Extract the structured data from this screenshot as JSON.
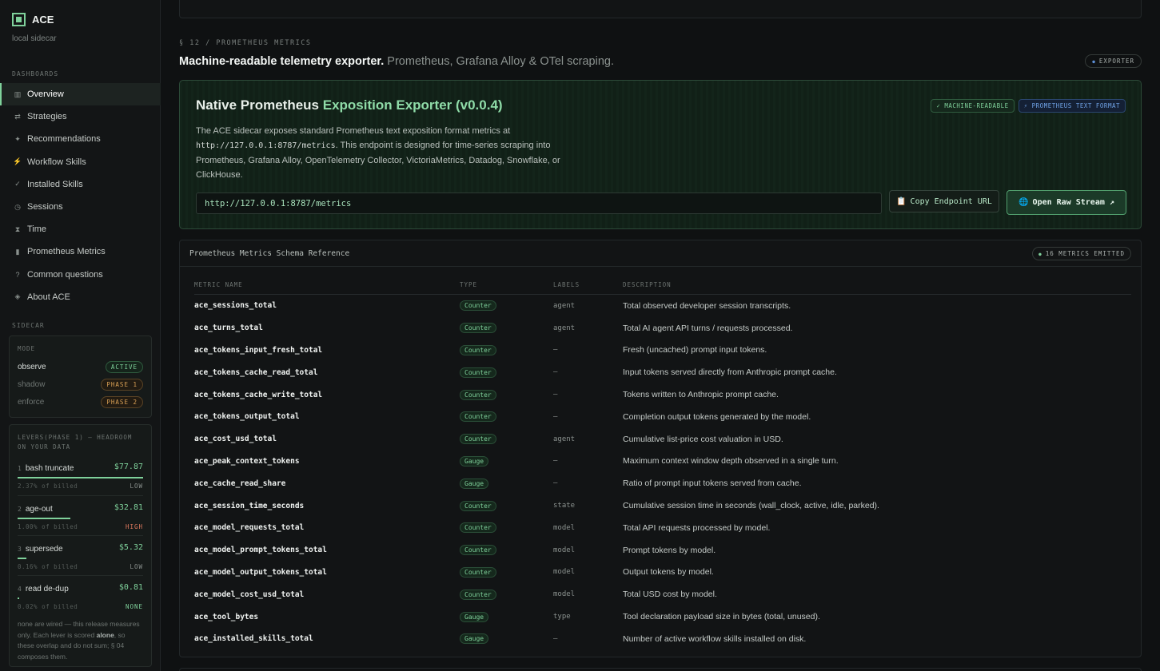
{
  "brand": {
    "name": "ACE",
    "subtitle": "local sidecar"
  },
  "sidebar": {
    "dashboards_label": "DASHBOARDS",
    "items": [
      {
        "icon": "grid-icon",
        "glyph": "▥",
        "label": "Overview",
        "active": true
      },
      {
        "icon": "arrows-icon",
        "glyph": "⇄",
        "label": "Strategies"
      },
      {
        "icon": "sparkle-icon",
        "glyph": "✦",
        "label": "Recommendations"
      },
      {
        "icon": "bolt-icon",
        "glyph": "⚡",
        "label": "Workflow Skills"
      },
      {
        "icon": "check-icon",
        "glyph": "✓",
        "label": "Installed Skills"
      },
      {
        "icon": "clock-icon",
        "glyph": "◷",
        "label": "Sessions"
      },
      {
        "icon": "hourglass-icon",
        "glyph": "⧗",
        "label": "Time"
      },
      {
        "icon": "bar-chart-icon",
        "glyph": "▮",
        "label": "Prometheus Metrics"
      },
      {
        "icon": "question-icon",
        "glyph": "?",
        "label": "Common questions"
      },
      {
        "icon": "diamond-icon",
        "glyph": "◈",
        "label": "About ACE"
      }
    ],
    "sidecar_label": "SIDECAR",
    "mode": {
      "label": "MODE",
      "rows": [
        {
          "name": "observe",
          "badge": "ACTIVE",
          "tone": "green"
        },
        {
          "name": "shadow",
          "badge": "PHASE 1",
          "tone": "amber"
        },
        {
          "name": "enforce",
          "badge": "PHASE 2",
          "tone": "amber"
        }
      ]
    },
    "levers": {
      "label_line1": "LEVERS(PHASE 1) — HEADROOM",
      "label_line2": "ON YOUR DATA",
      "items": [
        {
          "num": "1",
          "name": "bash truncate",
          "value": "$77.87",
          "pct": "2.37% of billed",
          "risk": "LOW",
          "fill": 1.0
        },
        {
          "num": "2",
          "name": "age-out",
          "value": "$32.81",
          "pct": "1.00% of billed",
          "risk": "HIGH",
          "fill": 0.42
        },
        {
          "num": "3",
          "name": "supersede",
          "value": "$5.32",
          "pct": "0.16% of billed",
          "risk": "LOW",
          "fill": 0.07
        },
        {
          "num": "4",
          "name": "read de-dup",
          "value": "$0.81",
          "pct": "0.02% of billed",
          "risk": "NONE",
          "fill": 0.01
        }
      ],
      "note_pre": "none are wired — this release measures only. Each lever is scored ",
      "note_bold": "alone",
      "note_post": ", so these overlap and do not sum; § 04 composes them."
    }
  },
  "section": {
    "kicker": "§ 12 / PROMETHEUS METRICS",
    "title_bold": "Machine-readable telemetry exporter.",
    "title_rest": " Prometheus, Grafana Alloy & OTel scraping.",
    "pill": "EXPORTER"
  },
  "hero": {
    "title_a": "Native Prometheus ",
    "title_b": "Exposition Exporter (v0.0.4)",
    "badge_a": "✓ MACHINE-READABLE",
    "badge_b": "⚡ PROMETHEUS TEXT FORMAT",
    "desc_a": "The ACE sidecar exposes standard Prometheus text exposition format metrics at ",
    "desc_code": "http://127.0.0.1:8787/metrics",
    "desc_b": ". This endpoint is designed for time-series scraping into Prometheus, Grafana Alloy, OpenTelemetry Collector, VictoriaMetrics, Datadog, Snowflake, or ClickHouse.",
    "url": "http://127.0.0.1:8787/metrics",
    "copy_label": "Copy Endpoint URL",
    "open_label": "Open Raw Stream ↗"
  },
  "schema": {
    "title": "Prometheus Metrics Schema Reference",
    "count": "16 METRICS EMITTED",
    "headers": {
      "name": "METRIC NAME",
      "type": "TYPE",
      "labels": "LABELS",
      "desc": "DESCRIPTION"
    },
    "rows": [
      {
        "name": "ace_sessions_total",
        "type": "Counter",
        "labels": "agent",
        "desc": "Total observed developer session transcripts."
      },
      {
        "name": "ace_turns_total",
        "type": "Counter",
        "labels": "agent",
        "desc": "Total AI agent API turns / requests processed."
      },
      {
        "name": "ace_tokens_input_fresh_total",
        "type": "Counter",
        "labels": "—",
        "desc": "Fresh (uncached) prompt input tokens."
      },
      {
        "name": "ace_tokens_cache_read_total",
        "type": "Counter",
        "labels": "—",
        "desc": "Input tokens served directly from Anthropic prompt cache."
      },
      {
        "name": "ace_tokens_cache_write_total",
        "type": "Counter",
        "labels": "—",
        "desc": "Tokens written to Anthropic prompt cache."
      },
      {
        "name": "ace_tokens_output_total",
        "type": "Counter",
        "labels": "—",
        "desc": "Completion output tokens generated by the model."
      },
      {
        "name": "ace_cost_usd_total",
        "type": "Counter",
        "labels": "agent",
        "desc": "Cumulative list-price cost valuation in USD."
      },
      {
        "name": "ace_peak_context_tokens",
        "type": "Gauge",
        "labels": "—",
        "desc": "Maximum context window depth observed in a single turn."
      },
      {
        "name": "ace_cache_read_share",
        "type": "Gauge",
        "labels": "—",
        "desc": "Ratio of prompt input tokens served from cache."
      },
      {
        "name": "ace_session_time_seconds",
        "type": "Counter",
        "labels": "state",
        "desc": "Cumulative session time in seconds (wall_clock, active, idle, parked)."
      },
      {
        "name": "ace_model_requests_total",
        "type": "Counter",
        "labels": "model",
        "desc": "Total API requests processed by model."
      },
      {
        "name": "ace_model_prompt_tokens_total",
        "type": "Counter",
        "labels": "model",
        "desc": "Prompt tokens by model."
      },
      {
        "name": "ace_model_output_tokens_total",
        "type": "Counter",
        "labels": "model",
        "desc": "Output tokens by model."
      },
      {
        "name": "ace_model_cost_usd_total",
        "type": "Counter",
        "labels": "model",
        "desc": "Total USD cost by model."
      },
      {
        "name": "ace_tool_bytes",
        "type": "Gauge",
        "labels": "type",
        "desc": "Tool declaration payload size in bytes (total, unused)."
      },
      {
        "name": "ace_installed_skills_total",
        "type": "Gauge",
        "labels": "—",
        "desc": "Number of active workflow skills installed on disk."
      }
    ]
  }
}
